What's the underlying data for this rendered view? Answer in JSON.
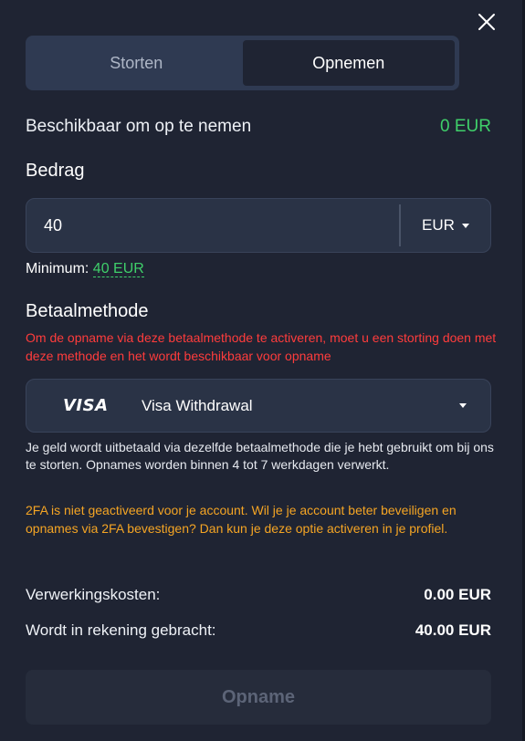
{
  "tabs": [
    {
      "label": "Storten",
      "active": false
    },
    {
      "label": "Opnemen",
      "active": true
    }
  ],
  "available": {
    "label": "Beschikbaar om op te nemen",
    "value": "0 EUR"
  },
  "amount": {
    "heading": "Bedrag",
    "value": "40",
    "currency": "EUR",
    "minimum_label": "Minimum:",
    "minimum_value": "40 EUR"
  },
  "payment": {
    "heading": "Betaalmethode",
    "warning": "Om de opname via deze betaalmethode te activeren, moet u een storting doen met deze methode en het wordt beschikbaar voor opname",
    "method_logo": "VISA",
    "method_name": "Visa Withdrawal",
    "info": "Je geld wordt uitbetaald via dezelfde betaalmethode die je hebt gebruikt om bij ons te storten. Opnames worden binnen 4 tot 7 werkdagen verwerkt.",
    "twofa_warning": "2FA is niet geactiveerd voor je account. Wil je je account beter beveiligen en opnames via 2FA bevestigen? Dan kun je deze optie activeren in je profiel."
  },
  "fees": {
    "processing_label": "Verwerkingskosten:",
    "processing_value": "0.00 EUR",
    "credited_label": "Wordt in rekening gebracht:",
    "credited_value": "40.00 EUR"
  },
  "submit_label": "Opname",
  "icons": {
    "close": "close-icon",
    "currency_caret": "caret-down-icon",
    "method_caret": "caret-down-icon"
  },
  "colors": {
    "accent_green": "#3fcf6a",
    "warning_red": "#ff3c3c",
    "warning_orange": "#f5a524",
    "background": "#1f2433"
  }
}
